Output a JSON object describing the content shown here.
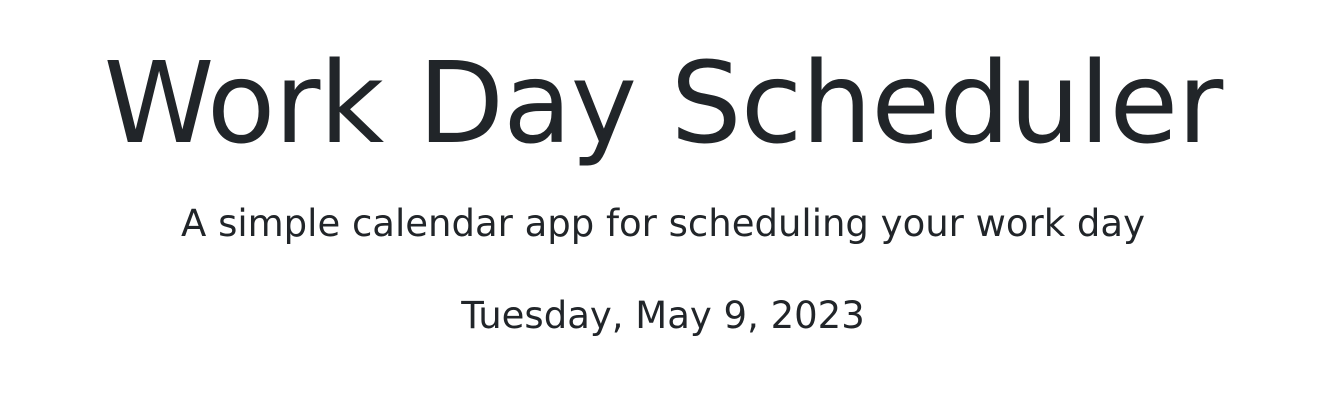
{
  "header": {
    "title": "Work Day Scheduler",
    "subtitle": "A simple calendar app for scheduling your work day",
    "current_day": "Tuesday, May 9, 2023"
  },
  "colors": {
    "text": "#212529",
    "background": "#ffffff"
  }
}
